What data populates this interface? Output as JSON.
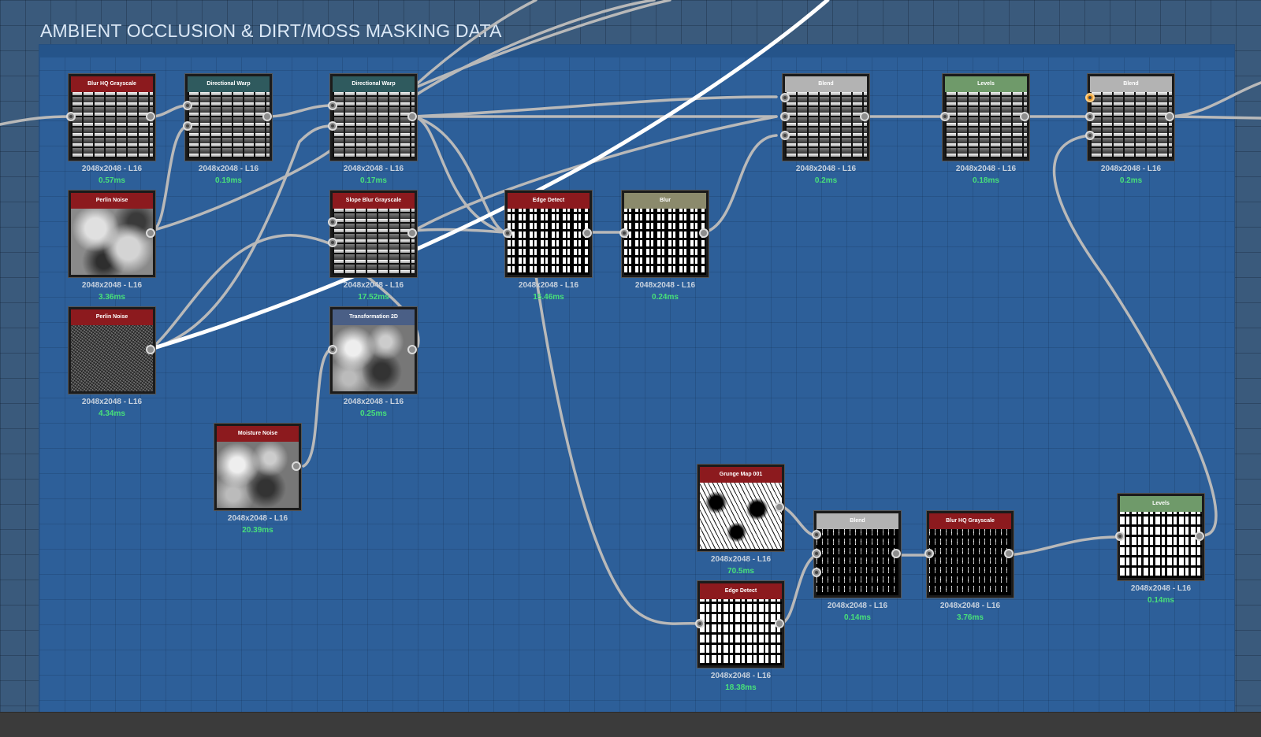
{
  "frame": {
    "title": "AMBIENT OCCLUSION & DIRT/MOSS MASKING DATA"
  },
  "colors": {
    "header_red": "#8c1a1e",
    "header_teal": "#2f5a5e",
    "header_gray": "#b3b3b3",
    "header_green": "#6f9a6a",
    "header_olive": "#8b8a6c",
    "header_slate": "#4a5f86",
    "timing_green": "#48e07a",
    "frame_blue": "#2d5f99"
  },
  "nodes": [
    {
      "name": "Blur HQ Grayscale",
      "res": "2048x2048 - L16",
      "time": "0.57ms"
    },
    {
      "name": "Directional Warp",
      "res": "2048x2048 - L16",
      "time": "0.19ms"
    },
    {
      "name": "Directional Warp",
      "res": "2048x2048 - L16",
      "time": "0.17ms"
    },
    {
      "name": "Blend",
      "res": "2048x2048 - L16",
      "time": "0.2ms"
    },
    {
      "name": "Levels",
      "res": "2048x2048 - L16",
      "time": "0.18ms"
    },
    {
      "name": "Blend",
      "res": "2048x2048 - L16",
      "time": "0.2ms"
    },
    {
      "name": "Perlin Noise",
      "res": "2048x2048 - L16",
      "time": "3.36ms"
    },
    {
      "name": "Slope Blur Grayscale",
      "res": "2048x2048 - L16",
      "time": "17.52ms"
    },
    {
      "name": "Edge Detect",
      "res": "2048x2048 - L16",
      "time": "15.46ms"
    },
    {
      "name": "Blur",
      "res": "2048x2048 - L16",
      "time": "0.24ms"
    },
    {
      "name": "Perlin Noise",
      "res": "2048x2048 - L16",
      "time": "4.34ms"
    },
    {
      "name": "Transformation 2D",
      "res": "2048x2048 - L16",
      "time": "0.25ms"
    },
    {
      "name": "Moisture Noise",
      "res": "2048x2048 - L16",
      "time": "20.39ms"
    },
    {
      "name": "Grunge Map 001",
      "res": "2048x2048 - L16",
      "time": "70.5ms"
    },
    {
      "name": "Edge Detect",
      "res": "2048x2048 - L16",
      "time": "18.38ms"
    },
    {
      "name": "Blend",
      "res": "2048x2048 - L16",
      "time": "0.14ms"
    },
    {
      "name": "Blur HQ Grayscale",
      "res": "2048x2048 - L16",
      "time": "3.76ms"
    },
    {
      "name": "Levels",
      "res": "2048x2048 - L16",
      "time": "0.14ms"
    }
  ]
}
